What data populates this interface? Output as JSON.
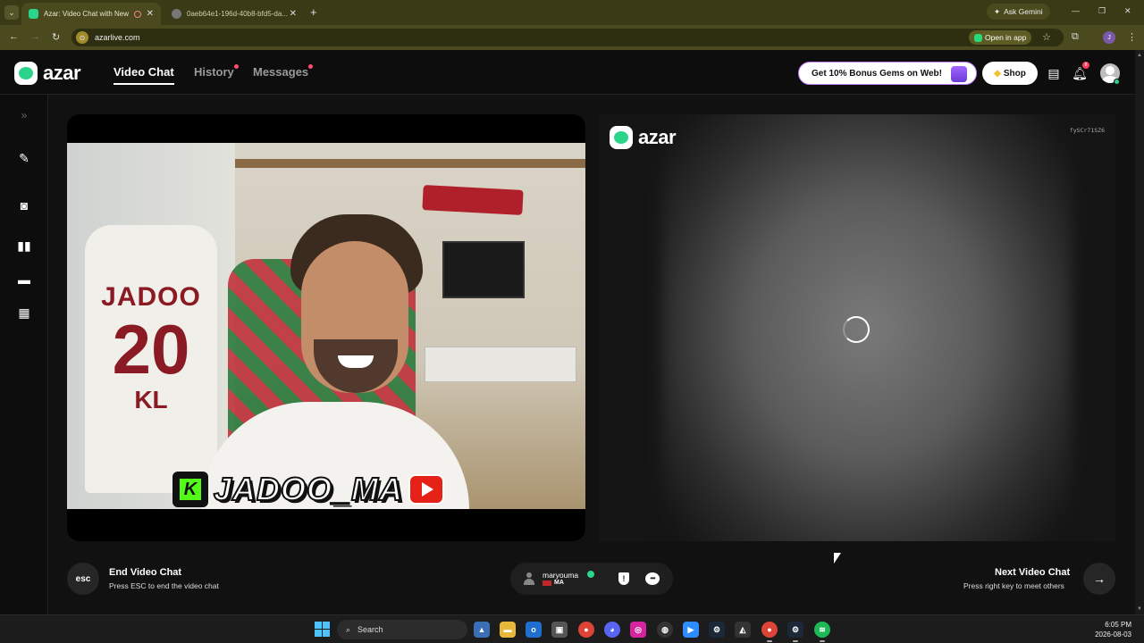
{
  "browser": {
    "tabs": [
      {
        "title": "Azar: Video Chat with New",
        "active": true
      },
      {
        "title": "0aeb64e1-196d-40b8-bfd5-da...",
        "active": false
      }
    ],
    "ask_gemini": "Ask Gemini",
    "url": "azarlive.com",
    "open_in_app": "Open in app",
    "profile_initial": "J"
  },
  "header": {
    "logo": "azar",
    "nav": [
      "Video Chat",
      "History",
      "Messages"
    ],
    "promo": "Get 10% Bonus Gems on Web!",
    "shop": "Shop",
    "notification_count": "8"
  },
  "local_video": {
    "jersey_name": "JADOO",
    "jersey_number": "20",
    "jersey_initials": "KL",
    "banner_name": "JADOO_MA",
    "kick_letter": "K"
  },
  "remote_video": {
    "logo": "azar",
    "session_id": "fySCr71SZ6"
  },
  "controls": {
    "esc_label": "esc",
    "end_title": "End Video Chat",
    "end_sub": "Press ESC to end the video chat",
    "username": "maryouma",
    "country": "MA",
    "next_title": "Next Video Chat",
    "next_sub": "Press right key to meet others"
  },
  "taskbar": {
    "search": "Search",
    "time": "6:05 PM",
    "date": "2026-08-03"
  },
  "colors": {
    "brand_green": "#2bd48b",
    "chrome_tab": "#3a3a16",
    "notification": "#ff3b5c"
  }
}
